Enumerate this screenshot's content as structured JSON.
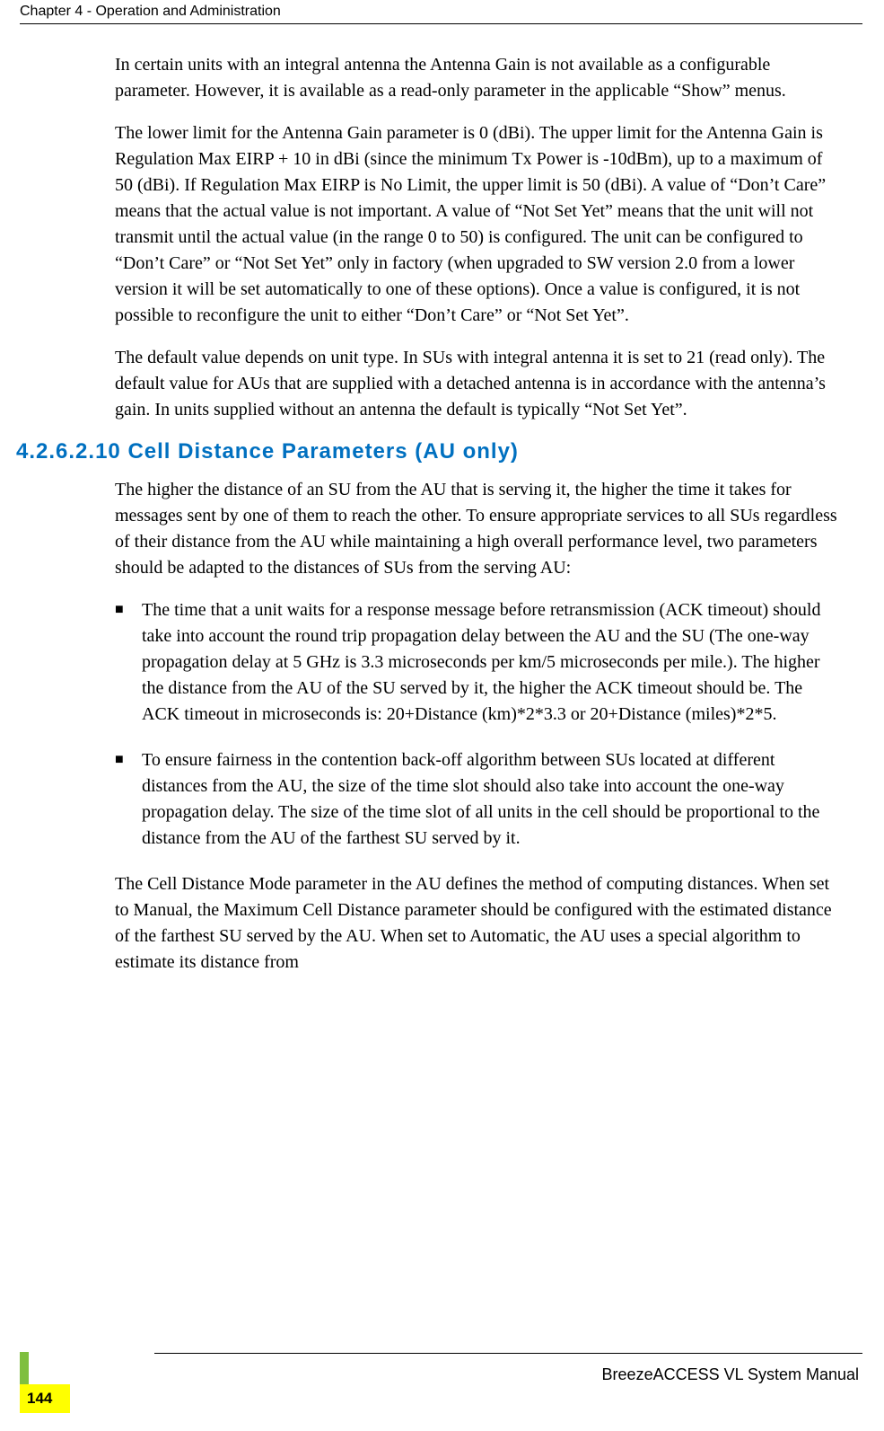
{
  "header": {
    "chapter": "Chapter 4 - Operation and Administration"
  },
  "body": {
    "p1": "In certain units with an integral antenna the Antenna Gain is not available as a configurable parameter. However, it is available as a read-only parameter in the applicable “Show” menus.",
    "p2": "The lower limit for the Antenna Gain parameter is 0 (dBi). The upper limit for the Antenna Gain is Regulation Max EIRP + 10 in dBi (since the minimum Tx Power is -10dBm), up to a maximum of 50 (dBi). If Regulation Max EIRP is No Limit, the upper limit is 50 (dBi). A value of “Don’t Care” means that the actual value is not important. A value of “Not Set Yet” means that the unit will not transmit until the actual value (in the range 0 to 50) is configured. The unit can be configured to “Don’t Care” or “Not Set Yet” only in factory (when upgraded to SW version 2.0 from a lower version it will be set automatically to one of these options). Once a value is configured, it is not possible to reconfigure the unit to either “Don’t Care” or “Not Set Yet”.",
    "p3": "The default value depends on unit type. In SUs with integral antenna it is set to 21 (read only). The default value for AUs that are supplied with a detached antenna is in accordance with the antenna’s gain. In units supplied without an antenna the default is typically “Not Set Yet”.",
    "section_number": "4.2.6.2.10",
    "section_title": "Cell Distance Parameters (AU only)",
    "p4": "The higher the distance of an SU from the AU that is serving it, the higher the time it takes for messages sent by one of them to reach the other. To ensure appropriate services to all SUs regardless of their distance from the AU while maintaining a high overall performance level, two parameters should be adapted to the distances of SUs from the serving AU:",
    "bullets": [
      "The time that a unit waits for a response message before retransmission (ACK timeout) should take into account the round trip propagation delay between the AU and the SU (The one-way propagation delay at 5 GHz is 3.3 microseconds per km/5 microseconds per mile.). The higher the distance from the AU of the SU served by it, the higher the ACK timeout should be. The ACK timeout in microseconds is: 20+Distance (km)*2*3.3 or 20+Distance (miles)*2*5.",
      "To ensure fairness in the contention back-off algorithm between SUs located at different distances from the AU, the size of the time slot should also take into account the one-way propagation delay. The size of the time slot of all units in the cell should be proportional to the distance from the AU of the farthest SU served by it."
    ],
    "p5": "The Cell Distance Mode parameter in the AU defines the method of computing distances. When set to Manual, the Maximum Cell Distance parameter should be configured with the estimated distance of the farthest SU served by the AU. When set to Automatic, the AU uses a special algorithm to estimate its distance from"
  },
  "footer": {
    "manual": "BreezeACCESS VL System Manual",
    "page": "144"
  }
}
